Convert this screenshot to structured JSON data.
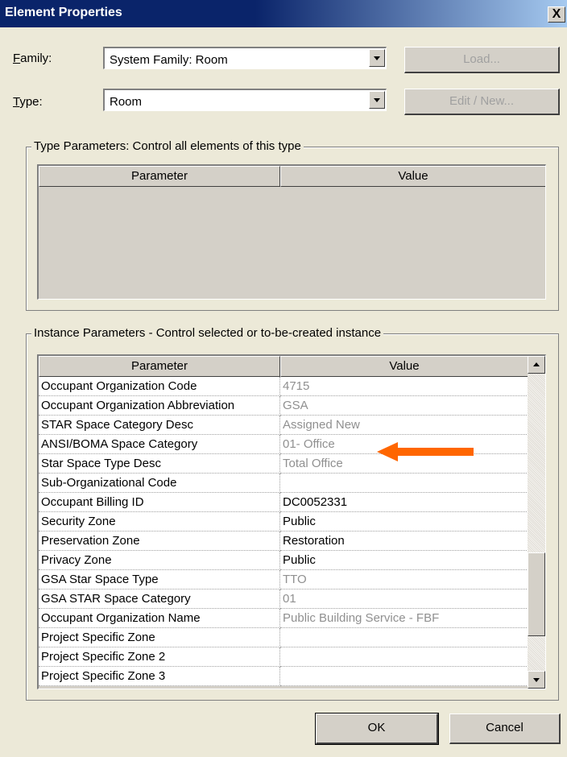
{
  "window": {
    "title": "Element Properties",
    "close_label": "X"
  },
  "family": {
    "label_underline": "F",
    "label_rest": "amily:",
    "value": "System Family: Room",
    "load_button": "Load..."
  },
  "type": {
    "label_underline": "T",
    "label_rest": "ype:",
    "value": "Room",
    "edit_button": "Edit / New..."
  },
  "type_parameters": {
    "group_title": "Type Parameters: Control all elements of this type",
    "col_parameter": "Parameter",
    "col_value": "Value"
  },
  "instance_parameters": {
    "group_title": "Instance Parameters - Control selected or to-be-created instance",
    "col_parameter": "Parameter",
    "col_value": "Value",
    "rows": [
      {
        "parameter": "Occupant Organization Code",
        "value": "4715",
        "readonly": true
      },
      {
        "parameter": "Occupant Organization Abbreviation",
        "value": "GSA",
        "readonly": true
      },
      {
        "parameter": "STAR Space Category Desc",
        "value": "Assigned New",
        "readonly": true
      },
      {
        "parameter": "ANSI/BOMA Space Category",
        "value": "01- Office",
        "readonly": true
      },
      {
        "parameter": "Star Space Type Desc",
        "value": "Total Office",
        "readonly": true
      },
      {
        "parameter": "Sub-Organizational Code",
        "value": "",
        "readonly": false
      },
      {
        "parameter": "Occupant Billing ID",
        "value": "DC0052331",
        "readonly": false
      },
      {
        "parameter": "Security Zone",
        "value": "Public",
        "readonly": false
      },
      {
        "parameter": "Preservation Zone",
        "value": "Restoration",
        "readonly": false
      },
      {
        "parameter": "Privacy Zone",
        "value": "Public",
        "readonly": false
      },
      {
        "parameter": "GSA Star Space Type",
        "value": "TTO",
        "readonly": true
      },
      {
        "parameter": "GSA STAR Space Category",
        "value": "01",
        "readonly": true
      },
      {
        "parameter": "Occupant Organization Name",
        "value": "Public Building Service - FBF",
        "readonly": true
      },
      {
        "parameter": "Project Specific Zone",
        "value": "",
        "readonly": false
      },
      {
        "parameter": "Project Specific Zone 2",
        "value": "",
        "readonly": false
      },
      {
        "parameter": "Project Specific Zone 3",
        "value": "",
        "readonly": false
      }
    ]
  },
  "buttons": {
    "ok": "OK",
    "cancel": "Cancel"
  },
  "colors": {
    "annotation_arrow": "#ff6600",
    "readonly_text": "#909090"
  }
}
